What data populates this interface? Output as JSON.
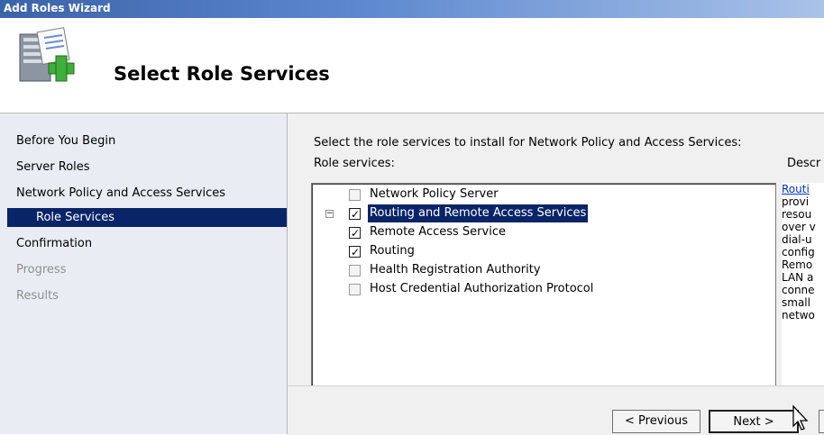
{
  "window": {
    "title": "Add Roles Wizard"
  },
  "header": {
    "title": "Select Role Services",
    "icon": "server-add-icon"
  },
  "sidebar": {
    "items": [
      {
        "label": "Before You Begin",
        "state": "normal"
      },
      {
        "label": "Server Roles",
        "state": "normal"
      },
      {
        "label": "Network Policy and Access Services",
        "state": "normal"
      },
      {
        "label": "Role Services",
        "state": "selected"
      },
      {
        "label": "Confirmation",
        "state": "normal"
      },
      {
        "label": "Progress",
        "state": "disabled"
      },
      {
        "label": "Results",
        "state": "disabled"
      }
    ]
  },
  "main": {
    "instruction": "Select the role services to install for Network Policy and Access Services:",
    "role_services_label": "Role services:",
    "description_label": "Descr",
    "tree": [
      {
        "label": "Network Policy Server",
        "checked": false
      },
      {
        "label": "Routing and Remote Access Services",
        "checked": true,
        "expanded": true,
        "selected": true
      },
      {
        "label": "Remote Access Service",
        "checked": true
      },
      {
        "label": "Routing",
        "checked": true
      },
      {
        "label": "Health Registration Authority",
        "checked": false
      },
      {
        "label": "Host Credential Authorization Protocol",
        "checked": false
      }
    ],
    "expander_symbol": "−",
    "check_symbol": "✓",
    "description": {
      "link": "Routi",
      "lines": [
        "provi",
        "resou",
        "over v",
        "dial-u",
        "config",
        "Remo",
        "LAN a",
        "conne",
        "small",
        "netwo"
      ]
    }
  },
  "buttons": {
    "previous": "< Previous",
    "next": "Next >"
  },
  "colors": {
    "selection": "#0a2468",
    "sidebar_bg": "#e9edf3",
    "titlebar": "#3b63a8"
  }
}
